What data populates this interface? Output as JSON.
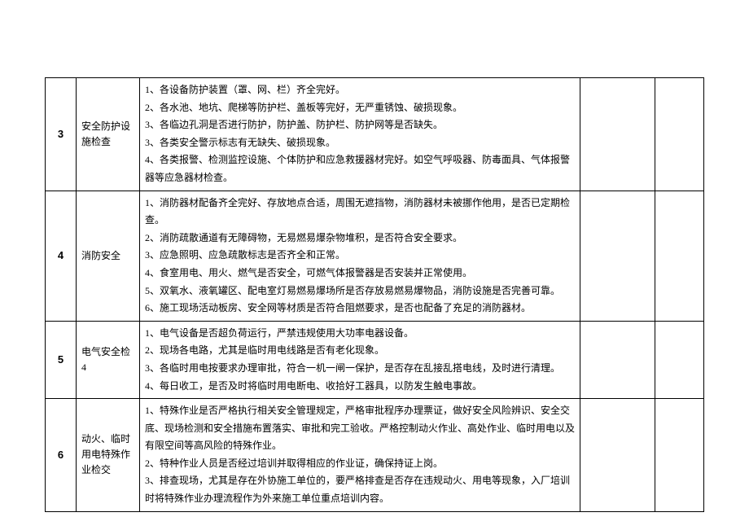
{
  "rows": [
    {
      "num": "3",
      "category": "安全防护设施检查",
      "desc": "1、各设备防护装置（罩、网、栏）齐全完好。\n2、各水池、地坑、爬梯等防护栏、盖板等完好，无严重锈蚀、破损现象。\n3、各临边孔洞是否进行防护，防护盖、防护栏、防护网等是否缺失。\n3、各类安全警示标志有无缺失、破损现象。\n4、各类报警、检测监控设施、个体防护和应急救援器材完好。如空气呼吸器、防毒面具、气体报警器等应急器材检查。"
    },
    {
      "num": "4",
      "category": "消防安全",
      "desc": "1、消防器材配备齐全完好、存放地点合适，周围无遮挡物，消防器材未被挪作他用，是否已定期检查。\n2、消防疏散通道有无障碍物，无易燃易爆杂物堆积，是否符合安全要求。\n3、应急照明、应急疏散标志是否齐全和正常。\n4、食室用电、用火、燃气是否安全，可燃气体报警器是否安装并正常使用。\n5、双氧水、液氧罐区、配电室灯易燃易爆场所是否存放易燃易爆物品，消防设施是否完善可靠。\n6、施工现场活动板房、安全网等材质是否符合阻燃要求，是否也配备了充足的消防器材。"
    },
    {
      "num": "5",
      "category": "电气安全检4",
      "desc": "1、电气设备是否超负荷运行，严禁违规使用大功率电器设备。\n2、现场各电路，尤其是临时用电线路是否有老化现象。\n3、各临时用电按要求办理审批，符合一机一闸一保护，是否存在乱接乱搭电线，及时进行清理。\n4、每日收工，是否及时将临时用电断电、收拾好工器具，以防发生触电事故。"
    },
    {
      "num": "6",
      "category": "动火、临时用电特殊作业检交",
      "desc": "1、特殊作业是否严格执行相关安全管理规定，严格审批程序办理票证，做好安全风险辨识、安全交底、现场检测和安全措施布置落实、审批和完工验收。严格控制动火作业、高处作业、临时用电以及有限空间等高风险的特殊作业。\n2、特种作业人员是否经过培训并取得相应的作业证，确保持证上岗。\n3、排查现场，尤其是存在外协施工单位的，要严格排查是否存在违规动火、用电等现象，入厂培训时将特殊作业办理流程作为外来施工单位重点培训内容。"
    }
  ]
}
